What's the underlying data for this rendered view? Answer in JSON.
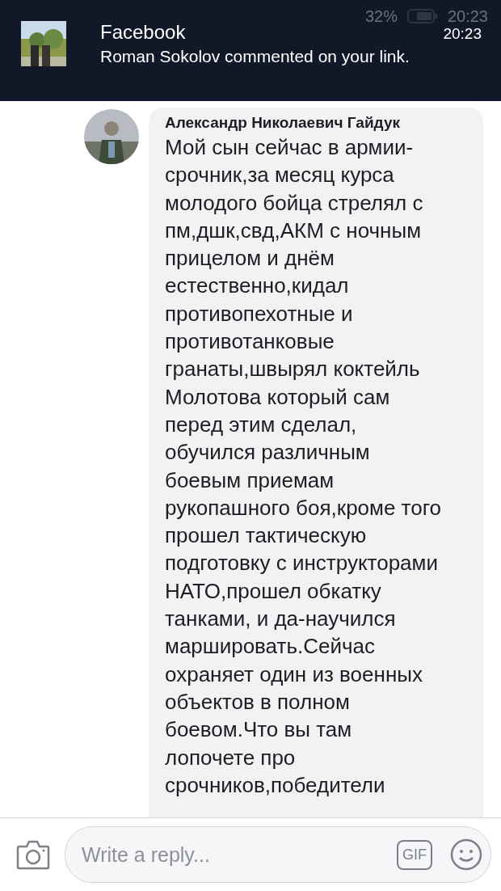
{
  "status_bar": {
    "battery": "32%",
    "time": "20:23"
  },
  "notification": {
    "app": "Facebook",
    "time": "20:23",
    "message": "Roman Sokolov commented on your link."
  },
  "comment": {
    "author": "Александр Николаевич Гайдук",
    "text": "Мой сын сейчас в армии-\nсрочник,за месяц курса\nмолодого бойца стрелял с\nпм,дшк,свд,АКМ с ночным\nприцелом и днём\nестественно,кидал\nпротивопехотные и\nпротивотанковые\nгранаты,швырял коктейль\nМолотова который сам\nперед этим сделал,\nобучился различным\nбоевым приемам\nрукопашного боя,кроме того\nпрошел тактическую\nподготовку с инструкторами\nНАТО,прошел обкатку\nтанками, и да-научился\nмаршировать.Сейчас\nохраняет один из военных\nобъектов в полном\nбоевом.Что вы там\nлопочете про\nсрочников,победители"
  },
  "reply_bar": {
    "placeholder": "Write a reply...",
    "gif": "GIF"
  }
}
